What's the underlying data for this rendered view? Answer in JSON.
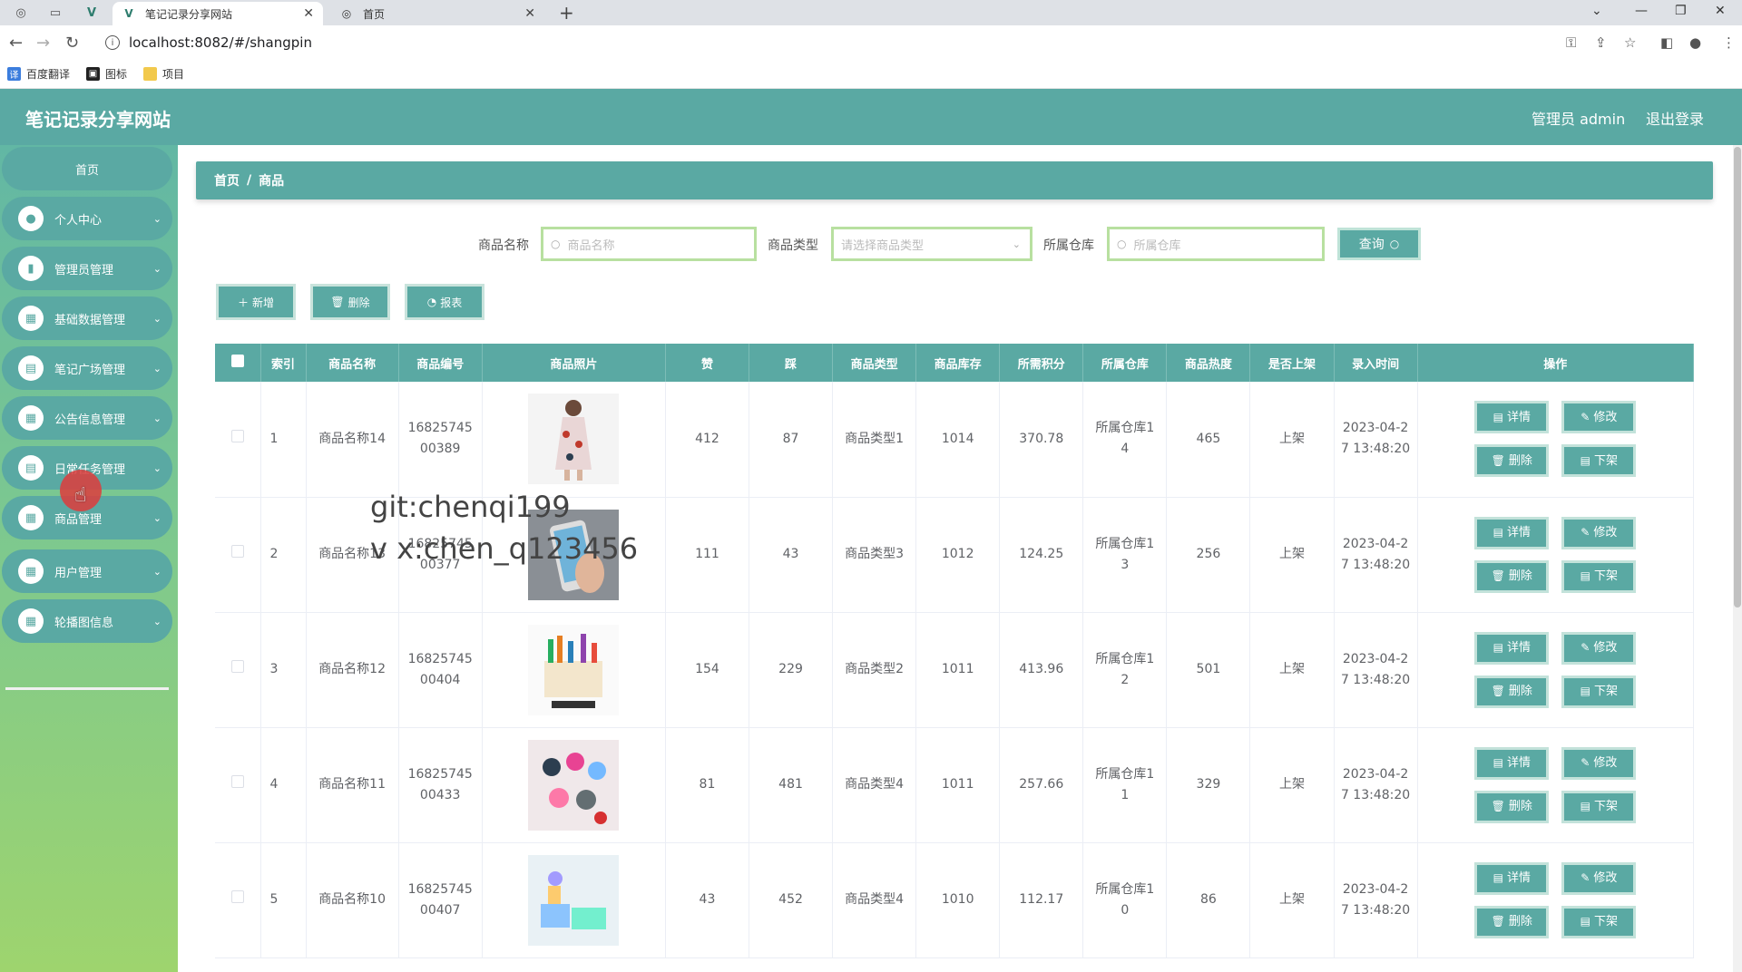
{
  "browser": {
    "tabs": [
      {
        "title": "笔记记录分享网站",
        "active": true
      },
      {
        "title": "首页",
        "active": false
      }
    ],
    "url": "localhost:8082/#/shangpin",
    "bookmarks": [
      "百度翻译",
      "图标",
      "项目"
    ]
  },
  "header": {
    "title": "笔记记录分享网站",
    "user": "管理员 admin",
    "logout": "退出登录"
  },
  "sidebar": {
    "home": "首页",
    "items": [
      {
        "label": "个人中心",
        "icon": "person-icon"
      },
      {
        "label": "管理员管理",
        "icon": "chart-icon"
      },
      {
        "label": "基础数据管理",
        "icon": "grid-icon"
      },
      {
        "label": "笔记广场管理",
        "icon": "document-icon"
      },
      {
        "label": "公告信息管理",
        "icon": "grid-icon"
      },
      {
        "label": "日常任务管理",
        "icon": "document-icon"
      },
      {
        "label": "商品管理",
        "icon": "grid-icon"
      },
      {
        "label": "用户管理",
        "icon": "grid-icon"
      },
      {
        "label": "轮播图信息",
        "icon": "grid-icon"
      }
    ]
  },
  "breadcrumb": {
    "home": "首页",
    "sep": "/",
    "current": "商品"
  },
  "search": {
    "name_label": "商品名称",
    "name_placeholder": "商品名称",
    "type_label": "商品类型",
    "type_placeholder": "请选择商品类型",
    "warehouse_label": "所属仓库",
    "warehouse_placeholder": "所属仓库",
    "query_button": "查询"
  },
  "toolbar": {
    "add": "新增",
    "delete": "删除",
    "report": "报表"
  },
  "table": {
    "columns": [
      "索引",
      "商品名称",
      "商品编号",
      "商品照片",
      "赞",
      "踩",
      "商品类型",
      "商品库存",
      "所需积分",
      "所属仓库",
      "商品热度",
      "是否上架",
      "录入时间",
      "操作"
    ],
    "rows": [
      {
        "index": "1",
        "name": "商品名称14",
        "code1": "16825745",
        "code2": "00389",
        "likes": "412",
        "dislikes": "87",
        "type": "商品类型1",
        "stock": "1014",
        "points": "370.78",
        "wh1": "所属仓库1",
        "wh2": "4",
        "heat": "465",
        "listed": "上架",
        "time1": "2023-04-2",
        "time2": "7 13:48:20",
        "photo": "dress"
      },
      {
        "index": "2",
        "name": "商品名称13",
        "code1": "16825745",
        "code2": "00377",
        "likes": "111",
        "dislikes": "43",
        "type": "商品类型3",
        "stock": "1012",
        "points": "124.25",
        "wh1": "所属仓库1",
        "wh2": "3",
        "heat": "256",
        "listed": "上架",
        "time1": "2023-04-2",
        "time2": "7 13:48:20",
        "photo": "phone"
      },
      {
        "index": "3",
        "name": "商品名称12",
        "code1": "16825745",
        "code2": "00404",
        "likes": "154",
        "dislikes": "229",
        "type": "商品类型2",
        "stock": "1011",
        "points": "413.96",
        "wh1": "所属仓库1",
        "wh2": "2",
        "heat": "501",
        "listed": "上架",
        "time1": "2023-04-2",
        "time2": "7 13:48:20",
        "photo": "organizer"
      },
      {
        "index": "4",
        "name": "商品名称11",
        "code1": "16825745",
        "code2": "00433",
        "likes": "81",
        "dislikes": "481",
        "type": "商品类型4",
        "stock": "1011",
        "points": "257.66",
        "wh1": "所属仓库1",
        "wh2": "1",
        "heat": "329",
        "listed": "上架",
        "time1": "2023-04-2",
        "time2": "7 13:48:20",
        "photo": "keychains"
      },
      {
        "index": "5",
        "name": "商品名称10",
        "code1": "16825745",
        "code2": "00407",
        "likes": "43",
        "dislikes": "452",
        "type": "商品类型4",
        "stock": "1010",
        "points": "112.17",
        "wh1": "所属仓库1",
        "wh2": "0",
        "heat": "86",
        "listed": "上架",
        "time1": "2023-04-2",
        "time2": "7 13:48:20",
        "photo": "containers"
      }
    ],
    "actions": {
      "detail": "详情",
      "edit": "修改",
      "delete": "删除",
      "unlist": "下架"
    }
  },
  "watermark": {
    "line1": "git:chenqi199",
    "line2": "v x:chen_q123456"
  },
  "colors": {
    "primary": "#5aa9a3",
    "sidebar_bottom": "#9ed46e",
    "input_border": "#b8e0a0"
  }
}
